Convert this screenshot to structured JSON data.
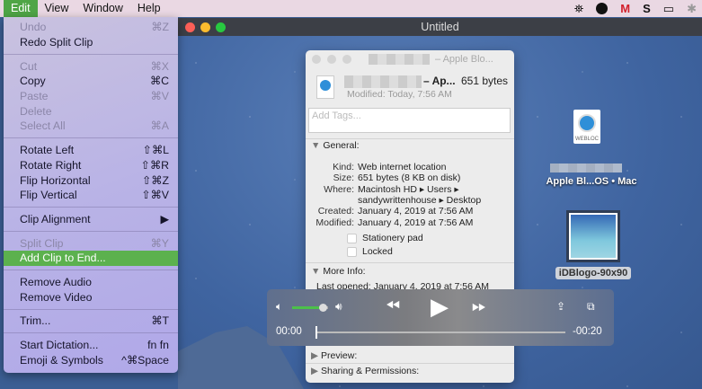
{
  "menubar": {
    "items": [
      "Edit",
      "View",
      "Window",
      "Help"
    ],
    "tray_icons": [
      "network-icon",
      "location-icon",
      "mcafee-icon",
      "s-icon",
      "airplay-icon",
      "bluetooth-icon"
    ]
  },
  "edit_menu": {
    "items": [
      {
        "label": "Undo",
        "shortcut": "⌘Z",
        "disabled": true
      },
      {
        "label": "Redo Split Clip",
        "shortcut": "",
        "disabled": false
      },
      {
        "sep": true
      },
      {
        "label": "Cut",
        "shortcut": "⌘X",
        "disabled": true
      },
      {
        "label": "Copy",
        "shortcut": "⌘C",
        "disabled": false
      },
      {
        "label": "Paste",
        "shortcut": "⌘V",
        "disabled": true
      },
      {
        "label": "Delete",
        "shortcut": "",
        "disabled": true
      },
      {
        "label": "Select All",
        "shortcut": "⌘A",
        "disabled": true
      },
      {
        "sep": true
      },
      {
        "label": "Rotate Left",
        "shortcut": "⇧⌘L",
        "disabled": false
      },
      {
        "label": "Rotate Right",
        "shortcut": "⇧⌘R",
        "disabled": false
      },
      {
        "label": "Flip Horizontal",
        "shortcut": "⇧⌘Z",
        "disabled": false
      },
      {
        "label": "Flip Vertical",
        "shortcut": "⇧⌘V",
        "disabled": false
      },
      {
        "sep": true
      },
      {
        "label": "Clip Alignment",
        "shortcut": "▶",
        "disabled": false
      },
      {
        "sep": true
      },
      {
        "label": "Split Clip",
        "shortcut": "⌘Y",
        "disabled": true
      },
      {
        "label": "Add Clip to End...",
        "shortcut": "",
        "disabled": false,
        "highlighted": true
      },
      {
        "sep": true
      },
      {
        "label": "Remove Audio",
        "shortcut": "",
        "disabled": false
      },
      {
        "label": "Remove Video",
        "shortcut": "",
        "disabled": false
      },
      {
        "sep": true
      },
      {
        "label": "Trim...",
        "shortcut": "⌘T",
        "disabled": false
      },
      {
        "sep": true
      },
      {
        "label": "Start Dictation...",
        "shortcut": "fn fn",
        "disabled": false
      },
      {
        "label": "Emoji & Symbols",
        "shortcut": "^⌘Space",
        "disabled": false
      }
    ]
  },
  "window": {
    "title": "Untitled"
  },
  "info_panel": {
    "title": "– Apple Blo...",
    "name": "– Ap...",
    "size": "651 bytes",
    "modified_short": "Modified: Today, 7:56 AM",
    "tags_placeholder": "Add Tags...",
    "general_label": "General:",
    "fields": [
      {
        "k": "Kind:",
        "v": "Web internet location"
      },
      {
        "k": "Size:",
        "v": "651 bytes (8 KB on disk)"
      },
      {
        "k": "Where:",
        "v": "Macintosh HD ▸ Users ▸"
      },
      {
        "k": "",
        "v": "sandywrittenhouse ▸ Desktop"
      },
      {
        "k": "Created:",
        "v": "January 4, 2019 at 7:56 AM"
      },
      {
        "k": "Modified:",
        "v": "January 4, 2019 at 7:56 AM"
      }
    ],
    "stationery": "Stationery pad",
    "locked": "Locked",
    "more_info": "More Info:",
    "last_opened": "Last opened: January 4, 2019 at 7:56 AM",
    "preview": "Preview:",
    "sharing": "Sharing & Permissions:"
  },
  "player": {
    "current": "00:00",
    "remaining": "-00:20",
    "volume": 0.85,
    "progress": 0
  },
  "desktop": {
    "webloc_badge": "WEBLOC",
    "webloc_name2": "Apple Bl...OS • Mac",
    "image_name": "iDBlogo-90x90"
  },
  "colors": {
    "accent": "#4fa546"
  }
}
